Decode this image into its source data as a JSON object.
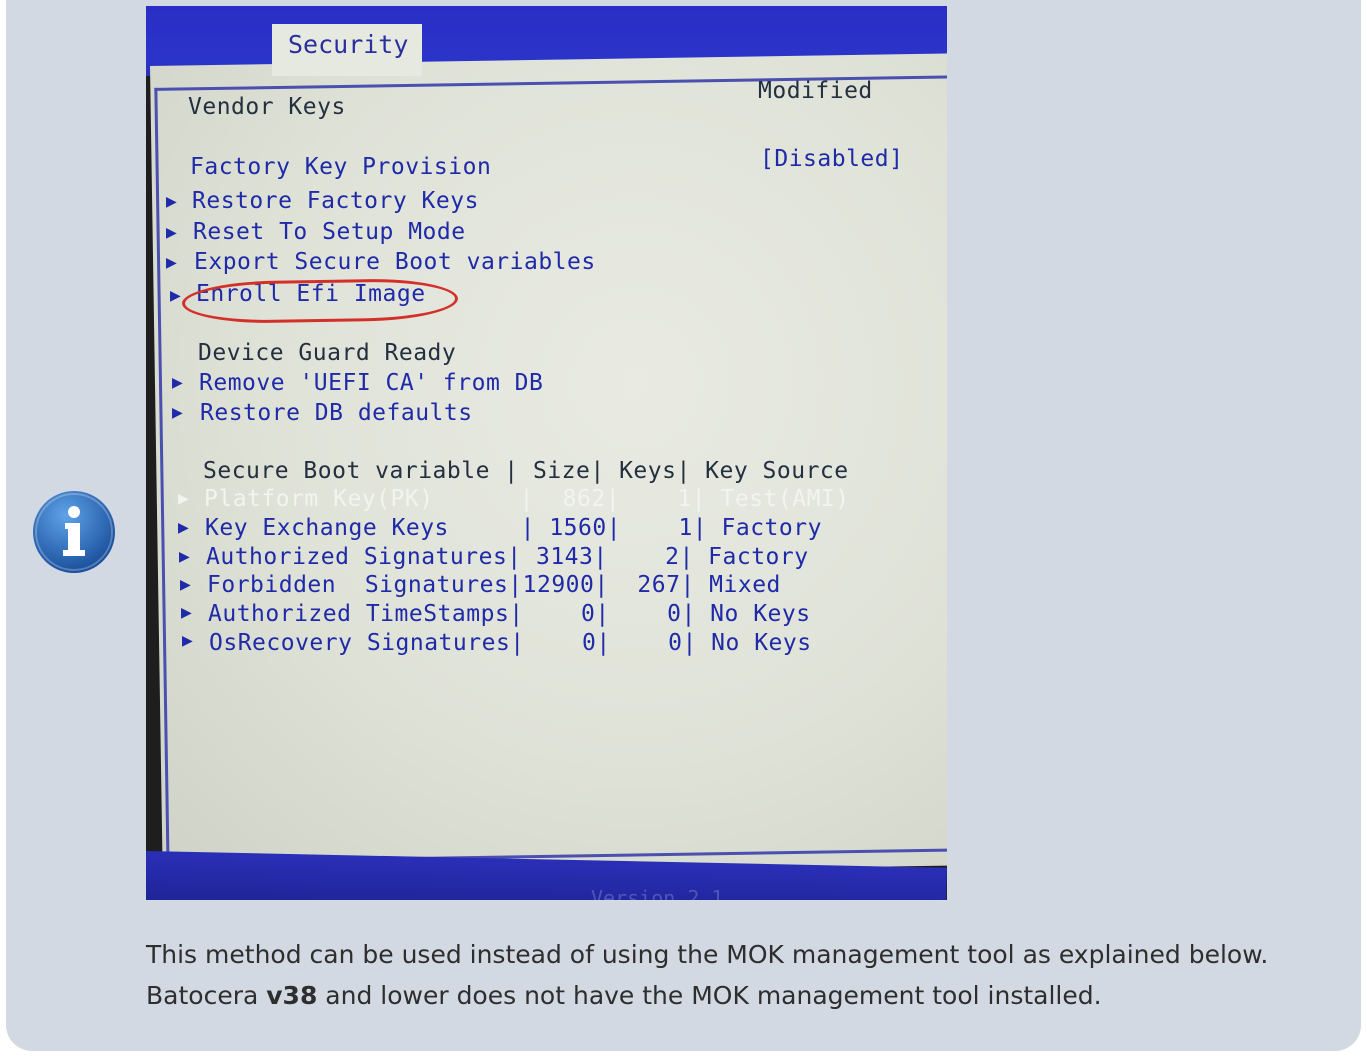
{
  "icon": {
    "name": "info-icon",
    "color": "#1a5fb4"
  },
  "bios": {
    "tab": "Security",
    "vendor_keys_label": "Vendor Keys",
    "vendor_keys_value": "Modified",
    "factory_key_label": "Factory Key Provision",
    "factory_key_value": "[Disabled]",
    "menu": [
      "Restore Factory Keys",
      "Reset To Setup Mode",
      "Export Secure Boot variables",
      "Enroll Efi Image"
    ],
    "device_guard_label": "Device Guard Ready",
    "device_guard_menu": [
      "Remove 'UEFI CA' from DB",
      "Restore DB defaults"
    ],
    "table_header": "Secure Boot variable | Size| Keys| Key Source",
    "table_rows": [
      "Platform Key(PK)      |  862|    1| Test(AMI)",
      "Key Exchange Keys     | 1560|    1| Factory",
      "Authorized Signatures| 3143|    2| Factory",
      "Forbidden  Signatures|12900|  267| Mixed",
      "Authorized TimeStamps|    0|    0| No Keys",
      "OsRecovery Signatures|    0|    0| No Keys"
    ],
    "footer": "Version 2.1"
  },
  "caption": {
    "line1": "This method can be used instead of using the MOK management tool as explained below.",
    "line2_prefix": "Batocera ",
    "line2_bold": "v38",
    "line2_suffix": " and lower does not have the MOK management tool installed."
  }
}
